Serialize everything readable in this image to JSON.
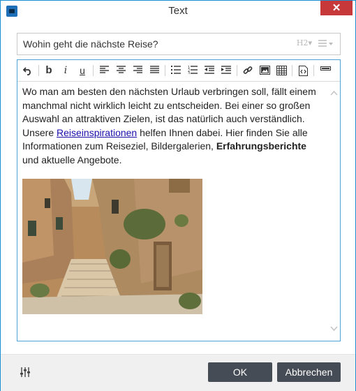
{
  "window": {
    "title": "Text",
    "close_glyph": "✕"
  },
  "subject": {
    "value": "Wohin geht die nächste Reise?",
    "heading_select": "H2▾",
    "list_select_icon": "list-icon"
  },
  "toolbar": {
    "undo_icon": "undo-icon",
    "bold": "b",
    "italic": "i",
    "underline": "u",
    "align_left_icon": "align-left-icon",
    "align_center_icon": "align-center-icon",
    "align_right_icon": "align-right-icon",
    "justify_icon": "justify-icon",
    "bullet_list_icon": "bullet-list-icon",
    "numbered_list_icon": "numbered-list-icon",
    "outdent_icon": "outdent-icon",
    "indent_icon": "indent-icon",
    "link_icon": "link-icon",
    "image_icon": "image-icon",
    "table_icon": "table-icon",
    "source_icon": "source-code-icon",
    "hr_icon": "horizontal-rule-icon"
  },
  "content": {
    "text_before_link": "Wo man am besten den nächsten Urlaub verbringen soll, fällt einem manchmal nicht wirklich leicht zu entscheiden. Bei einer so großen Auswahl an attraktiven Zielen, ist das natürlich auch verständlich. Unsere ",
    "link": "Reiseinspirationen",
    "text_after_link": " helfen Ihnen dabei. Hier finden Sie alle Informationen zum Reiseziel, Bildergalerien, ",
    "bold": "Erfahrungsberichte",
    "text_end": " und aktuelle Angebote."
  },
  "footer": {
    "settings_icon": "sliders-icon",
    "ok": "OK",
    "cancel": "Abbrechen"
  },
  "colors": {
    "accent": "#1b8fd1",
    "close": "#c7383b",
    "button": "#464c55",
    "link": "#1a0dab"
  }
}
